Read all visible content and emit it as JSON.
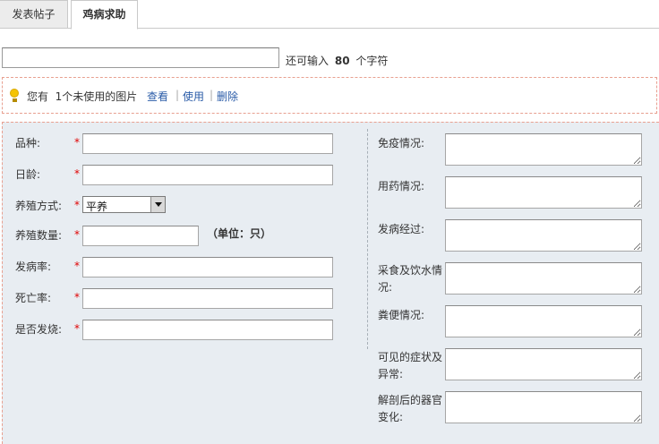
{
  "tabs": [
    {
      "label": "发表帖子",
      "active": false
    },
    {
      "label": "鸡病求助",
      "active": true
    }
  ],
  "title_field": {
    "value": "",
    "hint_prefix": "还可输入",
    "hint_count": "80",
    "hint_suffix": "个字符"
  },
  "attachment_notice": {
    "prefix": "您有",
    "text": "1个未使用的图片",
    "actions": [
      "查看",
      "使用",
      "删除"
    ],
    "separator": "|"
  },
  "form_left": {
    "required_mark": "*",
    "fields": [
      {
        "label": "品种:",
        "value": ""
      },
      {
        "label": "日龄:",
        "value": ""
      },
      {
        "label": "养殖方式:",
        "value": "平养"
      },
      {
        "label": "养殖数量:",
        "value": "",
        "unit": "（单位：只）"
      },
      {
        "label": "发病率:",
        "value": ""
      },
      {
        "label": "死亡率:",
        "value": ""
      },
      {
        "label": "是否发烧:",
        "value": ""
      }
    ]
  },
  "form_right": {
    "fields": [
      {
        "label": "免疫情况:",
        "value": ""
      },
      {
        "label": "用药情况:",
        "value": ""
      },
      {
        "label": "发病经过:",
        "value": ""
      },
      {
        "label_line1": "采食及饮水情",
        "label_line2": "况:",
        "value": ""
      },
      {
        "label": "粪便情况:",
        "value": ""
      },
      {
        "label_line1": "可见的症状及",
        "label_line2": "异常:",
        "value": ""
      },
      {
        "label_line1": "解剖后的器官",
        "label_line2": "变化:",
        "value": ""
      }
    ]
  }
}
